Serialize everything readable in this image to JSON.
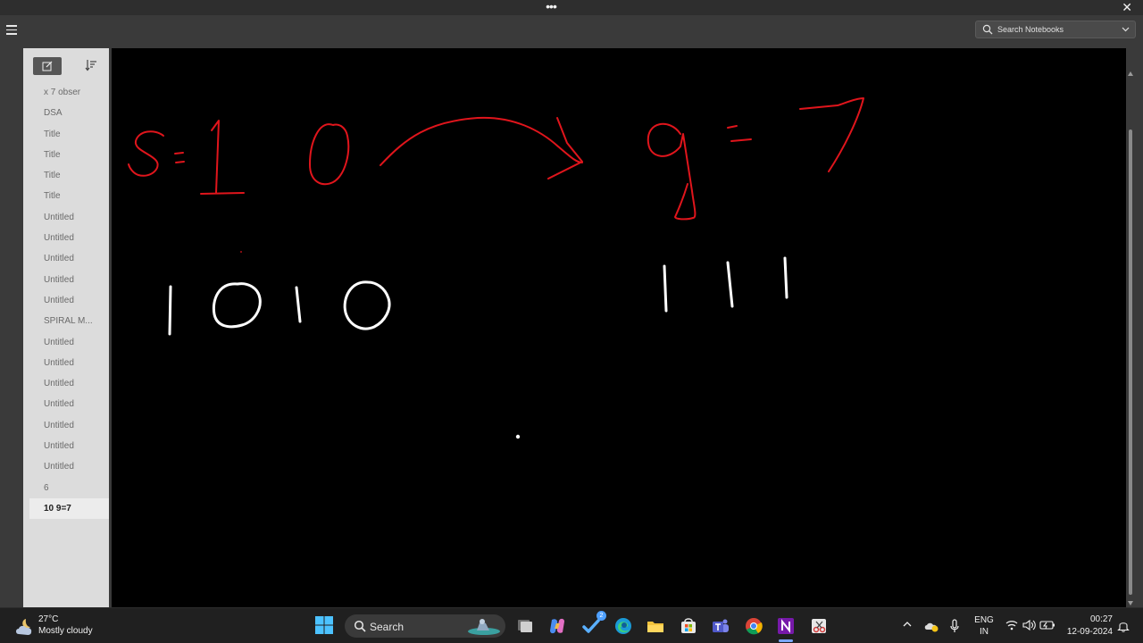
{
  "titlebar": {
    "menu_dots": "•••",
    "close_glyph": "✕"
  },
  "toolbar": {
    "search_notebooks_placeholder": "Search Notebooks"
  },
  "sidebar": {
    "pages": [
      {
        "label": "x 7 obser"
      },
      {
        "label": "DSA"
      },
      {
        "label": "Title"
      },
      {
        "label": "Title"
      },
      {
        "label": "Title"
      },
      {
        "label": "Title"
      },
      {
        "label": "Untitled"
      },
      {
        "label": "Untitled"
      },
      {
        "label": "Untitled"
      },
      {
        "label": "Untitled"
      },
      {
        "label": "Untitled"
      },
      {
        "label": "SPIRAL M..."
      },
      {
        "label": "Untitled"
      },
      {
        "label": "Untitled"
      },
      {
        "label": "Untitled"
      },
      {
        "label": "Untitled"
      },
      {
        "label": "Untitled"
      },
      {
        "label": "Untitled"
      },
      {
        "label": "Untitled"
      },
      {
        "label": "6"
      },
      {
        "label": "10 9=7",
        "selected": true
      }
    ]
  },
  "canvas": {
    "background": "#000000",
    "ink_colors": {
      "red": "#e0151c",
      "white": "#ffffff"
    },
    "handwriting": {
      "line1_left": "s=10",
      "line1_right": "9=7",
      "line2_left": "1010",
      "line2_right": "111"
    }
  },
  "taskbar": {
    "weather": {
      "temperature": "27°C",
      "condition": "Mostly cloudy",
      "icon": "partly-cloudy-night-icon"
    },
    "search_label": "Search",
    "apps": [
      {
        "name": "windows-start-icon"
      },
      {
        "name": "task-view-icon"
      },
      {
        "name": "copilot-icon"
      },
      {
        "name": "tasks-icon",
        "badge": "2"
      },
      {
        "name": "edge-icon"
      },
      {
        "name": "file-explorer-icon"
      },
      {
        "name": "microsoft-store-icon"
      },
      {
        "name": "teams-icon"
      },
      {
        "name": "chrome-icon"
      },
      {
        "name": "onenote-icon",
        "active": true
      },
      {
        "name": "snipping-tool-icon"
      }
    ],
    "language": {
      "line1": "ENG",
      "line2": "IN"
    },
    "clock": {
      "time": "00:27",
      "date": "12-09-2024"
    }
  }
}
